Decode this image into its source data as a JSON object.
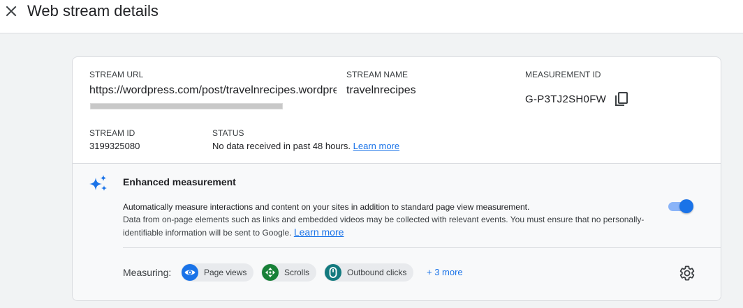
{
  "header": {
    "title": "Web stream details",
    "close_icon": "close-icon"
  },
  "stream": {
    "url_label": "STREAM URL",
    "url_value": "https://wordpress.com/post/travelnrecipes.wordpress.com",
    "name_label": "STREAM NAME",
    "name_value": "travelnrecipes",
    "measurement_label": "MEASUREMENT ID",
    "measurement_value": "G-P3TJ2SH0FW",
    "copy_icon": "copy-icon",
    "id_label": "STREAM ID",
    "id_value": "3199325080",
    "status_label": "STATUS",
    "status_value": "No data received in past 48 hours.",
    "status_link": "Learn more"
  },
  "enhanced": {
    "icon": "sparkle-icon",
    "title": "Enhanced measurement",
    "description_bold": "Automatically measure interactions and content on your sites in addition to standard page view measurement.",
    "description": "Data from on-page elements such as links and embedded videos may be collected with relevant events. You must ensure that no personally-identifiable information will be sent to Google.",
    "learn_more": "Learn more",
    "toggle_on": true,
    "measuring_label": "Measuring:",
    "chips": [
      {
        "label": "Page views",
        "icon": "eye-icon",
        "color": "#1a73e8"
      },
      {
        "label": "Scrolls",
        "icon": "scroll-arrows-icon",
        "color": "#188038"
      },
      {
        "label": "Outbound clicks",
        "icon": "mouse-icon",
        "color": "#137a7f"
      }
    ],
    "more": "+ 3 more",
    "settings_icon": "gear-icon"
  },
  "colors": {
    "accent": "#1a73e8",
    "page_bg": "#f1f3f4"
  }
}
